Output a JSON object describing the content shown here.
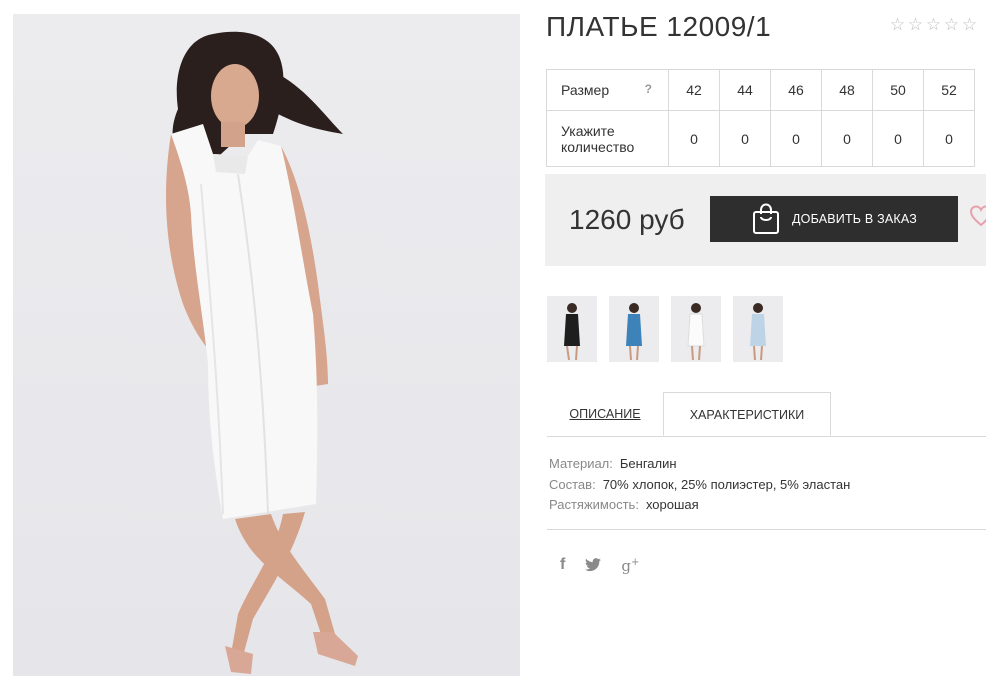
{
  "product": {
    "title": "ПЛАТЬЕ 12009/1",
    "rating": {
      "value": 0,
      "max": 5,
      "icon": "star-outline-icon"
    }
  },
  "size_table": {
    "size_label": "Размер",
    "size_hint": "?",
    "quantity_label": "Укажите количество",
    "sizes": [
      "42",
      "44",
      "46",
      "48",
      "50",
      "52"
    ],
    "quantities": [
      "0",
      "0",
      "0",
      "0",
      "0",
      "0"
    ]
  },
  "purchase": {
    "price": "1260 руб",
    "add_button_label": "ДОБАВИТЬ В ЗАКАЗ",
    "add_button_icon": "shopping-bag-icon",
    "wishlist_icon": "heart-icon",
    "colors": {
      "button_bg": "#2e2e2e",
      "box_bg": "#efefef",
      "heart": "#e8a0ad"
    }
  },
  "thumbnails": [
    {
      "name": "black-dress",
      "color": "#1e1e1e"
    },
    {
      "name": "blue-dress",
      "color": "#3d82b8"
    },
    {
      "name": "white-dress",
      "color": "#f7f7f7"
    },
    {
      "name": "light-blue-dress",
      "color": "#bdd3e6"
    }
  ],
  "tabs": {
    "description": "ОПИСАНИЕ",
    "specs": "ХАРАКТЕРИСТИКИ",
    "active": "specs"
  },
  "specs": [
    {
      "key": "Материал:",
      "value": "Бенгалин"
    },
    {
      "key": "Состав:",
      "value": "70% хлопок, 25% полиэстер, 5% эластан"
    },
    {
      "key": "Растяжимость:",
      "value": "хорошая"
    }
  ],
  "social": {
    "facebook": "f",
    "twitter": "🐦",
    "google_plus": "g+"
  }
}
